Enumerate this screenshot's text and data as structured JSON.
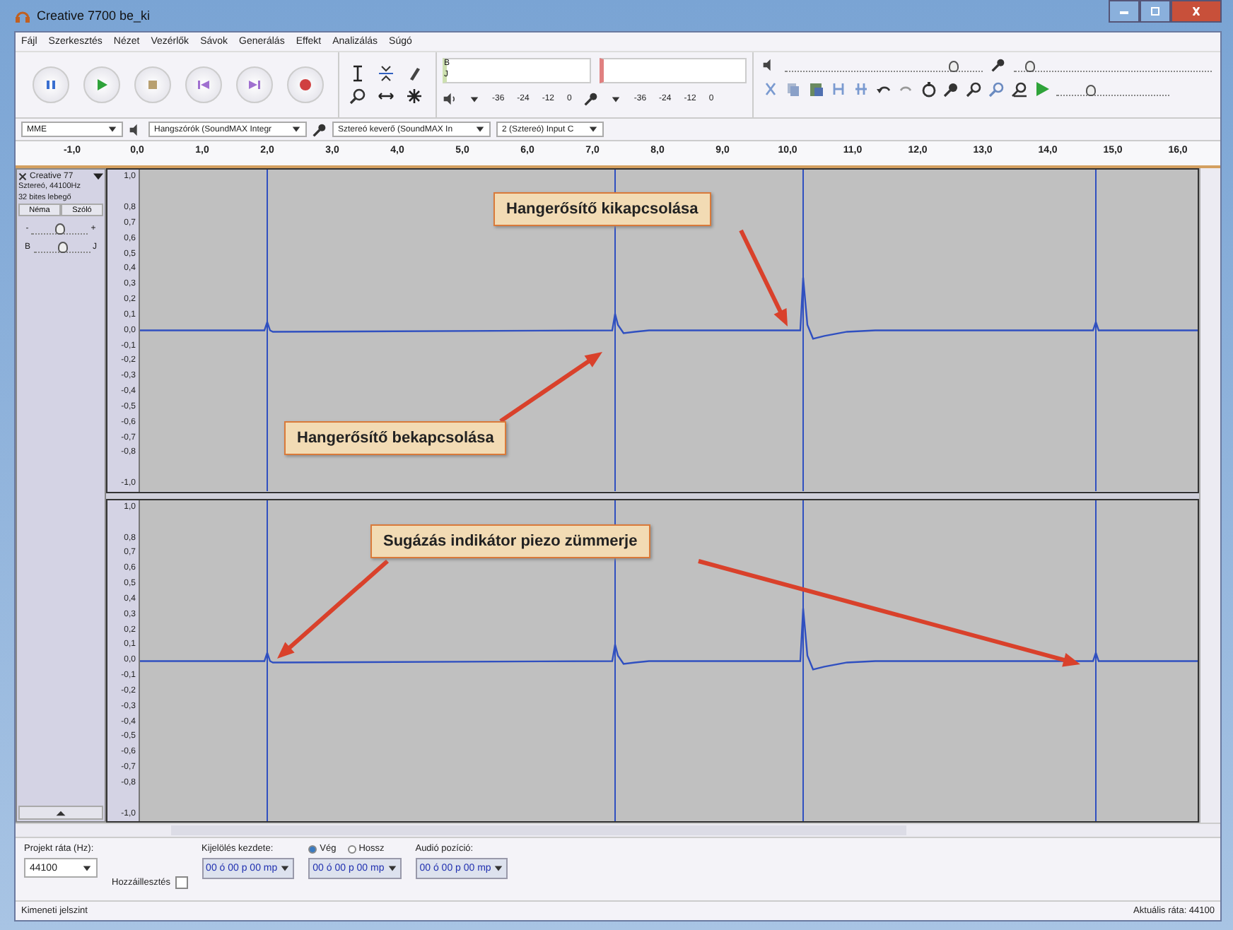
{
  "window": {
    "title": "Creative 7700 be_ki"
  },
  "menu": [
    "Fájl",
    "Szerkesztés",
    "Nézet",
    "Vezérlők",
    "Sávok",
    "Generálás",
    "Effekt",
    "Analizálás",
    "Súgó"
  ],
  "meters": {
    "channel_labels": [
      "B",
      "J"
    ],
    "scale_play": [
      "-36",
      "-24",
      "-12",
      "0"
    ],
    "scale_rec": [
      "-36",
      "-24",
      "-12",
      "0"
    ]
  },
  "mixer": {
    "output": {
      "level": 0.85
    },
    "input": {
      "level": 0.08
    }
  },
  "play_speed": {
    "level": 0.3
  },
  "devices": {
    "host": "MME",
    "output": "Hangszórók (SoundMAX Integr",
    "input": "Sztereó keverő (SoundMAX In",
    "channels": "2 (Sztereó) Input C"
  },
  "ruler": [
    "-1,0",
    "0,0",
    "1,0",
    "2,0",
    "3,0",
    "4,0",
    "5,0",
    "6,0",
    "7,0",
    "8,0",
    "9,0",
    "10,0",
    "11,0",
    "12,0",
    "13,0",
    "14,0",
    "15,0",
    "16,0"
  ],
  "track": {
    "name": "Creative 77",
    "info": [
      "Sztereó, 44100Hz",
      "32 bites lebegő"
    ],
    "mute": "Néma",
    "solo": "Szóló",
    "gain": {
      "min": "-",
      "max": "+",
      "level": 0.5
    },
    "pan": {
      "min": "B",
      "max": "J",
      "level": 0.5
    }
  },
  "channels": [
    {
      "scale": [
        "1,0",
        "0,8",
        "0,7",
        "0,6",
        "0,5",
        "0,4",
        "0,3",
        "0,2",
        "0,1",
        "0,0",
        "-0,1",
        "-0,2",
        "-0,3",
        "-0,4",
        "-0,5",
        "-0,6",
        "-0,7",
        "-0,8",
        "-1,0"
      ]
    },
    {
      "scale": [
        "1,0",
        "0,8",
        "0,7",
        "0,6",
        "0,5",
        "0,4",
        "0,3",
        "0,2",
        "0,1",
        "0,0",
        "-0,1",
        "-0,2",
        "-0,3",
        "-0,4",
        "-0,5",
        "-0,6",
        "-0,7",
        "-0,8",
        "-1,0"
      ]
    }
  ],
  "annotations": [
    "Hangerősítő kikapcsolása",
    "Hangerősítő bekapcsolása",
    "Sugázás indikátor piezo zümmerje"
  ],
  "selection_bar": {
    "rate_label": "Projekt ráta (Hz):",
    "rate": "44100",
    "snap_label": "Hozzáillesztés",
    "snap_checked": false,
    "start_label": "Kijelölés kezdete:",
    "options": [
      {
        "label": "Vég",
        "selected": true
      },
      {
        "label": "Hossz",
        "selected": false
      }
    ],
    "position_label": "Audió pozíció:",
    "times": [
      "00 ó 00 p 00 mp",
      "00 ó 00 p 00 mp",
      "00 ó 00 p 00 mp"
    ]
  },
  "status_bar": {
    "left": "Kimeneti jelszint",
    "right": "Aktuális ráta: 44100"
  }
}
